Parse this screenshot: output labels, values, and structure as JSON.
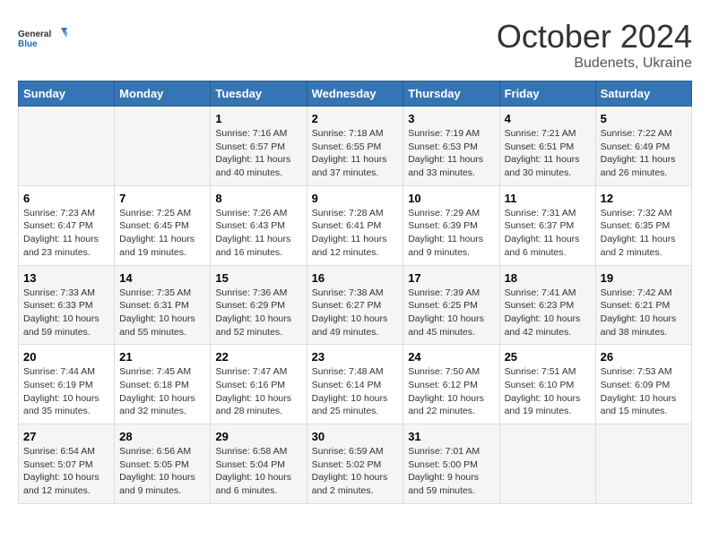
{
  "logo": {
    "line1": "General",
    "line2": "Blue"
  },
  "title": "October 2024",
  "subtitle": "Budenets, Ukraine",
  "days_of_week": [
    "Sunday",
    "Monday",
    "Tuesday",
    "Wednesday",
    "Thursday",
    "Friday",
    "Saturday"
  ],
  "weeks": [
    [
      {
        "day": "",
        "content": ""
      },
      {
        "day": "",
        "content": ""
      },
      {
        "day": "1",
        "content": "Sunrise: 7:16 AM\nSunset: 6:57 PM\nDaylight: 11 hours and 40 minutes."
      },
      {
        "day": "2",
        "content": "Sunrise: 7:18 AM\nSunset: 6:55 PM\nDaylight: 11 hours and 37 minutes."
      },
      {
        "day": "3",
        "content": "Sunrise: 7:19 AM\nSunset: 6:53 PM\nDaylight: 11 hours and 33 minutes."
      },
      {
        "day": "4",
        "content": "Sunrise: 7:21 AM\nSunset: 6:51 PM\nDaylight: 11 hours and 30 minutes."
      },
      {
        "day": "5",
        "content": "Sunrise: 7:22 AM\nSunset: 6:49 PM\nDaylight: 11 hours and 26 minutes."
      }
    ],
    [
      {
        "day": "6",
        "content": "Sunrise: 7:23 AM\nSunset: 6:47 PM\nDaylight: 11 hours and 23 minutes."
      },
      {
        "day": "7",
        "content": "Sunrise: 7:25 AM\nSunset: 6:45 PM\nDaylight: 11 hours and 19 minutes."
      },
      {
        "day": "8",
        "content": "Sunrise: 7:26 AM\nSunset: 6:43 PM\nDaylight: 11 hours and 16 minutes."
      },
      {
        "day": "9",
        "content": "Sunrise: 7:28 AM\nSunset: 6:41 PM\nDaylight: 11 hours and 12 minutes."
      },
      {
        "day": "10",
        "content": "Sunrise: 7:29 AM\nSunset: 6:39 PM\nDaylight: 11 hours and 9 minutes."
      },
      {
        "day": "11",
        "content": "Sunrise: 7:31 AM\nSunset: 6:37 PM\nDaylight: 11 hours and 6 minutes."
      },
      {
        "day": "12",
        "content": "Sunrise: 7:32 AM\nSunset: 6:35 PM\nDaylight: 11 hours and 2 minutes."
      }
    ],
    [
      {
        "day": "13",
        "content": "Sunrise: 7:33 AM\nSunset: 6:33 PM\nDaylight: 10 hours and 59 minutes."
      },
      {
        "day": "14",
        "content": "Sunrise: 7:35 AM\nSunset: 6:31 PM\nDaylight: 10 hours and 55 minutes."
      },
      {
        "day": "15",
        "content": "Sunrise: 7:36 AM\nSunset: 6:29 PM\nDaylight: 10 hours and 52 minutes."
      },
      {
        "day": "16",
        "content": "Sunrise: 7:38 AM\nSunset: 6:27 PM\nDaylight: 10 hours and 49 minutes."
      },
      {
        "day": "17",
        "content": "Sunrise: 7:39 AM\nSunset: 6:25 PM\nDaylight: 10 hours and 45 minutes."
      },
      {
        "day": "18",
        "content": "Sunrise: 7:41 AM\nSunset: 6:23 PM\nDaylight: 10 hours and 42 minutes."
      },
      {
        "day": "19",
        "content": "Sunrise: 7:42 AM\nSunset: 6:21 PM\nDaylight: 10 hours and 38 minutes."
      }
    ],
    [
      {
        "day": "20",
        "content": "Sunrise: 7:44 AM\nSunset: 6:19 PM\nDaylight: 10 hours and 35 minutes."
      },
      {
        "day": "21",
        "content": "Sunrise: 7:45 AM\nSunset: 6:18 PM\nDaylight: 10 hours and 32 minutes."
      },
      {
        "day": "22",
        "content": "Sunrise: 7:47 AM\nSunset: 6:16 PM\nDaylight: 10 hours and 28 minutes."
      },
      {
        "day": "23",
        "content": "Sunrise: 7:48 AM\nSunset: 6:14 PM\nDaylight: 10 hours and 25 minutes."
      },
      {
        "day": "24",
        "content": "Sunrise: 7:50 AM\nSunset: 6:12 PM\nDaylight: 10 hours and 22 minutes."
      },
      {
        "day": "25",
        "content": "Sunrise: 7:51 AM\nSunset: 6:10 PM\nDaylight: 10 hours and 19 minutes."
      },
      {
        "day": "26",
        "content": "Sunrise: 7:53 AM\nSunset: 6:09 PM\nDaylight: 10 hours and 15 minutes."
      }
    ],
    [
      {
        "day": "27",
        "content": "Sunrise: 6:54 AM\nSunset: 5:07 PM\nDaylight: 10 hours and 12 minutes."
      },
      {
        "day": "28",
        "content": "Sunrise: 6:56 AM\nSunset: 5:05 PM\nDaylight: 10 hours and 9 minutes."
      },
      {
        "day": "29",
        "content": "Sunrise: 6:58 AM\nSunset: 5:04 PM\nDaylight: 10 hours and 6 minutes."
      },
      {
        "day": "30",
        "content": "Sunrise: 6:59 AM\nSunset: 5:02 PM\nDaylight: 10 hours and 2 minutes."
      },
      {
        "day": "31",
        "content": "Sunrise: 7:01 AM\nSunset: 5:00 PM\nDaylight: 9 hours and 59 minutes."
      },
      {
        "day": "",
        "content": ""
      },
      {
        "day": "",
        "content": ""
      }
    ]
  ]
}
